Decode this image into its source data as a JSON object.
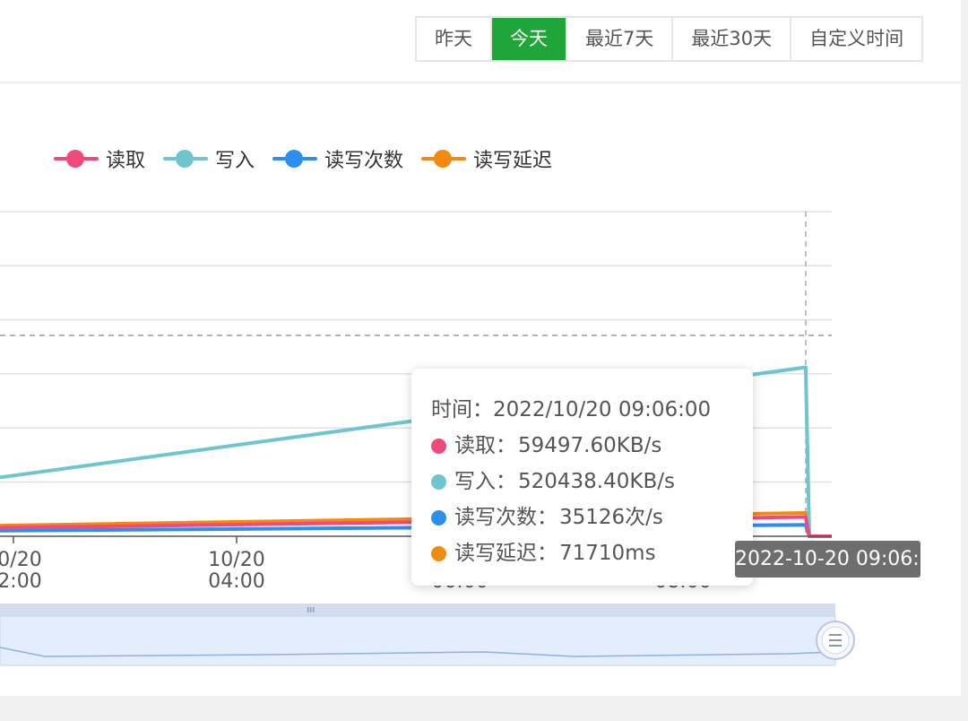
{
  "range_buttons": [
    "昨天",
    "今天",
    "最近7天",
    "最近30天",
    "自定义时间"
  ],
  "active_range": "今天",
  "legend": [
    {
      "label": "读取",
      "color": "#f2497c"
    },
    {
      "label": "写入",
      "color": "#6ec5d0"
    },
    {
      "label": "读写次数",
      "color": "#2b8ff0"
    },
    {
      "label": "读写延迟",
      "color": "#f28a0f"
    }
  ],
  "tooltip": {
    "time_label": "时间：",
    "time_value": "2022/10/20 09:06:00",
    "rows": [
      {
        "label": "读取：",
        "value": "59497.60KB/s",
        "color": "#f2497c"
      },
      {
        "label": "写入：",
        "value": "520438.40KB/s",
        "color": "#6ec5d0"
      },
      {
        "label": "读写次数：",
        "value": "35126次/s",
        "color": "#2b8ff0"
      },
      {
        "label": "读写延迟：",
        "value": "71710ms",
        "color": "#f28a0f"
      }
    ]
  },
  "axis_pointer_label": "2022-10-20 09:06:00",
  "chart_data": {
    "type": "line",
    "x_tick_labels": [
      {
        "date": "10/20",
        "time": "02:00"
      },
      {
        "date": "10/20",
        "time": "04:00"
      },
      {
        "date": "10/20",
        "time": "06:00"
      },
      {
        "date": "10/20",
        "time": "08:00"
      }
    ],
    "grid": true,
    "legend_position": "top",
    "series": [
      {
        "name": "读取",
        "color": "#f2497c",
        "points": [
          [
            "01:00",
            22000
          ],
          [
            "09:06",
            59497.6
          ],
          [
            "09:07",
            0
          ]
        ]
      },
      {
        "name": "写入",
        "color": "#6ec5d0",
        "points": [
          [
            "01:00",
            140000
          ],
          [
            "09:06",
            520438.4
          ],
          [
            "09:07",
            0
          ]
        ]
      },
      {
        "name": "读写次数",
        "color": "#2b8ff0",
        "points": [
          [
            "01:00",
            15000
          ],
          [
            "09:06",
            35126
          ],
          [
            "09:07",
            0
          ]
        ]
      },
      {
        "name": "读写延迟",
        "color": "#f28a0f",
        "points": [
          [
            "01:00",
            28000
          ],
          [
            "09:06",
            71710
          ],
          [
            "09:07",
            0
          ]
        ]
      }
    ],
    "y_range": [
      0,
      1000000
    ],
    "overview_slider": {
      "start_time": "01:00",
      "end_time": "09:07"
    }
  }
}
